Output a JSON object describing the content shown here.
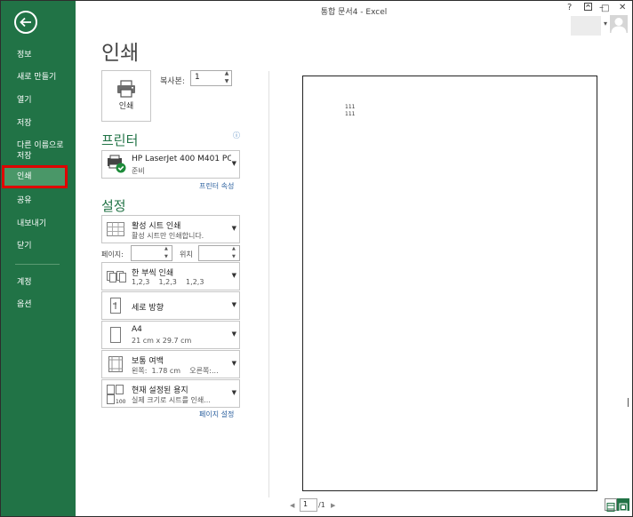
{
  "window": {
    "title": "통합 문서4 - Excel",
    "controls": [
      "?",
      "–",
      "□",
      "✕"
    ]
  },
  "sidebar": {
    "back_icon": "back-arrow-icon",
    "items": [
      {
        "label": "정보"
      },
      {
        "label": "새로 만들기"
      },
      {
        "label": "열기"
      },
      {
        "label": "저장"
      },
      {
        "label": "다른 이름으로\n저장"
      },
      {
        "label": "인쇄",
        "active": true
      },
      {
        "label": "공유"
      },
      {
        "label": "내보내기"
      },
      {
        "label": "닫기"
      },
      {
        "label": "계정"
      },
      {
        "label": "옵션"
      }
    ],
    "accent": "#217346",
    "highlight": "#e00000"
  },
  "main": {
    "title": "인쇄",
    "print_button": {
      "label": "인쇄"
    },
    "copies": {
      "label": "복사본:",
      "value": "1"
    },
    "printer": {
      "heading": "프린터",
      "name": "HP LaserJet 400 M401 PC...",
      "status": "준비",
      "properties_link": "프린터 속성"
    },
    "settings": {
      "heading": "설정",
      "scope": {
        "title": "활성 시트 인쇄",
        "sub": "활성 시트만 인쇄합니다."
      },
      "pages_label": "페이지:",
      "to_label": "위치",
      "collate": {
        "title": "한 부씩 인쇄",
        "sub": "1,2,3    1,2,3    1,2,3"
      },
      "orientation": {
        "title": "세로 방향"
      },
      "paper": {
        "title": "A4",
        "sub": "21 cm x 29.7 cm"
      },
      "margins": {
        "title": "보통 여백",
        "sub": "왼쪽:  1.78 cm    오른쪽:..."
      },
      "scaling": {
        "title": "현재 설정된 용지",
        "sub": "실제 크기로 시트를 인쇄..."
      },
      "page_setup_link": "페이지 설정"
    }
  },
  "preview": {
    "lines": [
      "111",
      "111"
    ],
    "current_page": "1",
    "total_pages": "/1"
  }
}
